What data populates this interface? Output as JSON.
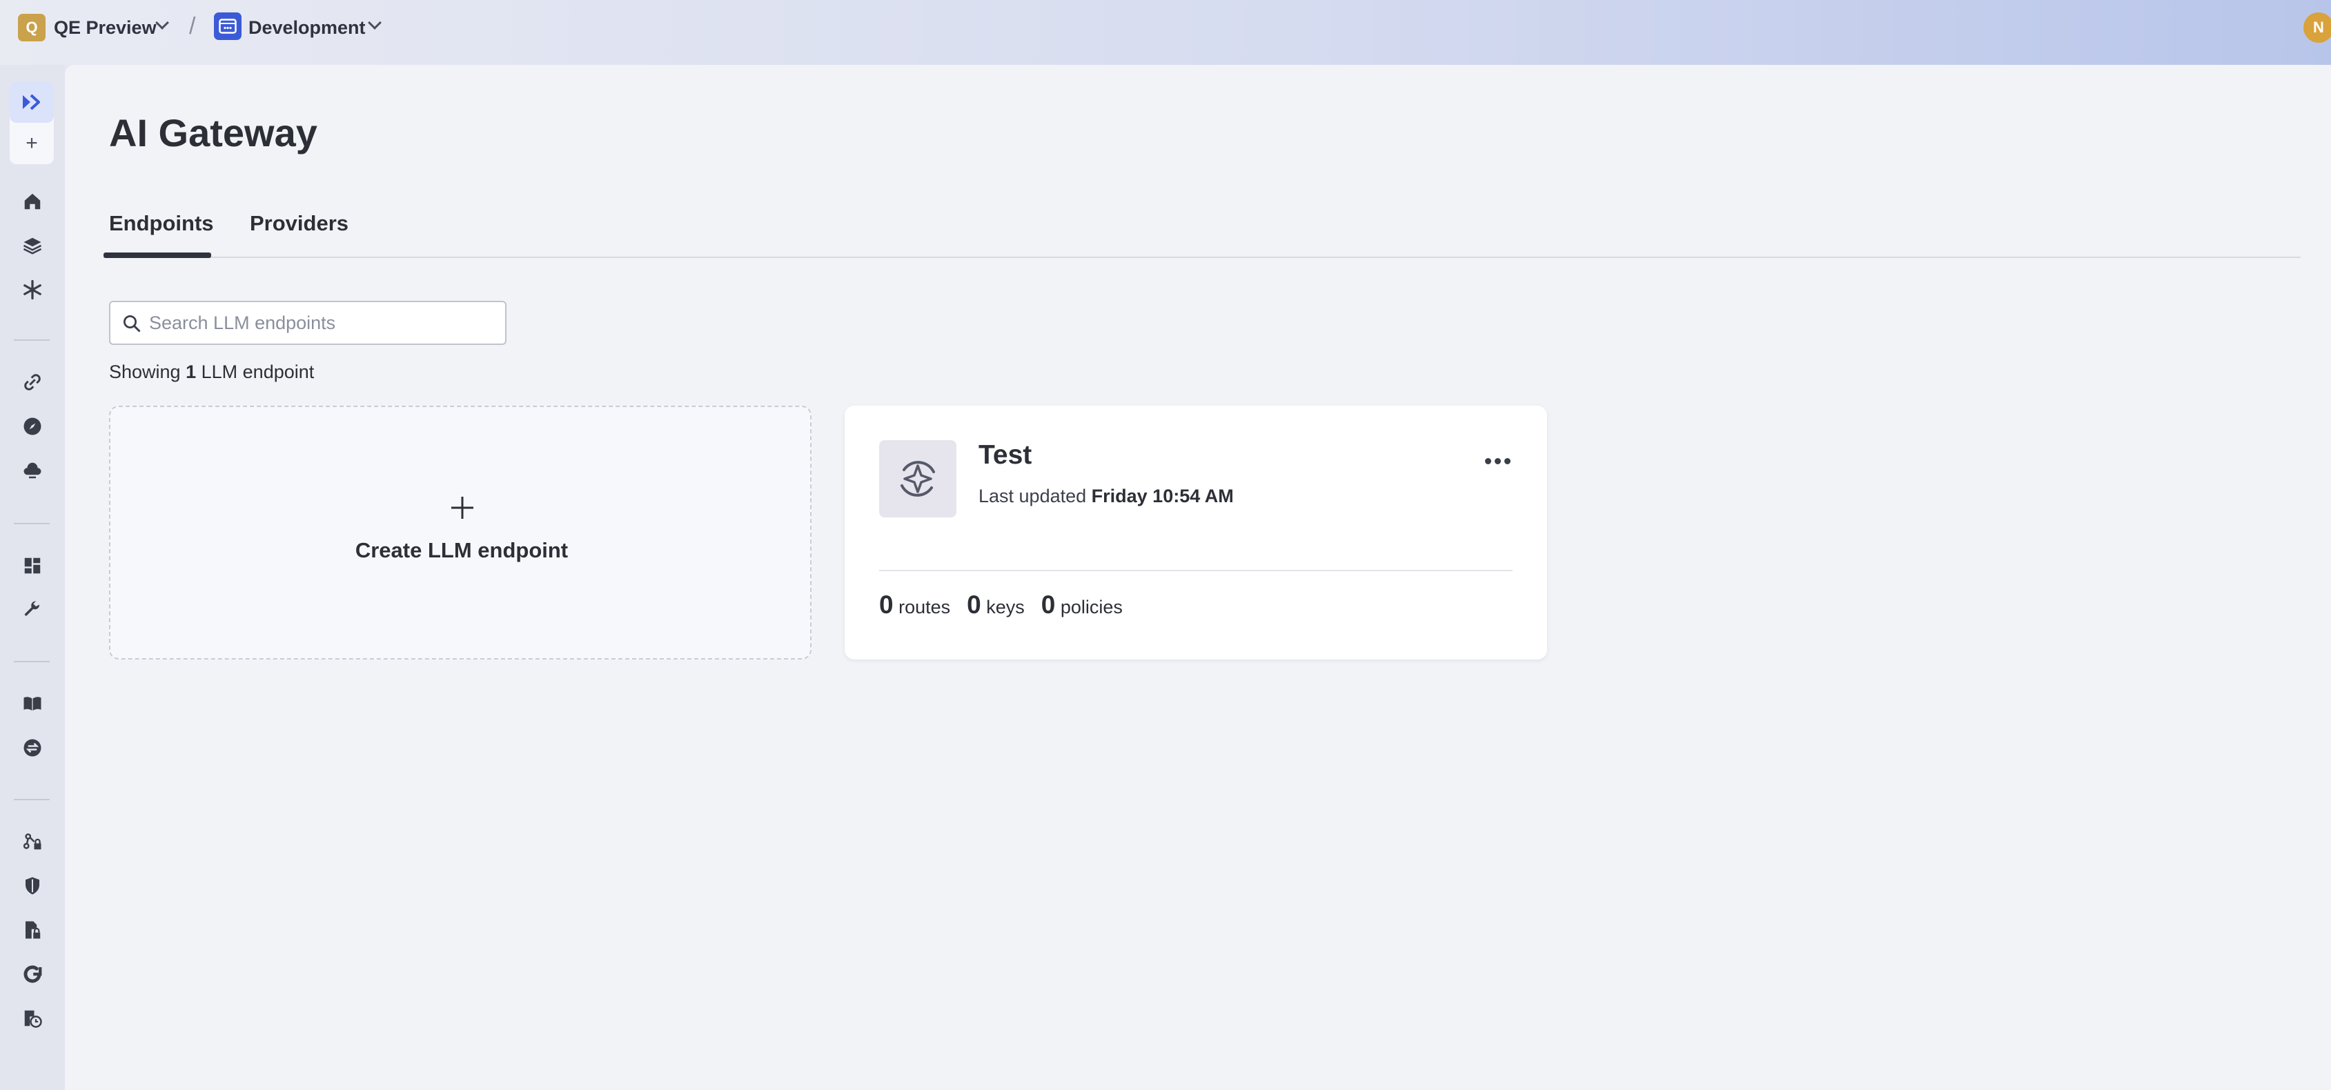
{
  "topbar": {
    "org": {
      "initial": "Q",
      "name": "QE Preview"
    },
    "environment": {
      "name": "Development"
    },
    "separator": "/",
    "user_initial": "N"
  },
  "sidebar": {
    "items": [
      {
        "icon": "collapse-sidebar-icon"
      },
      {
        "icon": "plus-icon",
        "label": "+"
      },
      {
        "icon": "home-icon"
      },
      {
        "icon": "layers-icon"
      },
      {
        "icon": "snowflake-icon"
      },
      {
        "icon": "link-icon"
      },
      {
        "icon": "compass-icon"
      },
      {
        "icon": "cloud-icon"
      },
      {
        "icon": "dashboard-icon"
      },
      {
        "icon": "wrench-icon"
      },
      {
        "icon": "book-icon"
      },
      {
        "icon": "swap-icon"
      },
      {
        "icon": "network-lock-icon"
      },
      {
        "icon": "shield-icon"
      },
      {
        "icon": "document-lock-icon"
      },
      {
        "icon": "refresh-icon"
      },
      {
        "icon": "history-icon"
      }
    ]
  },
  "page": {
    "title": "AI Gateway",
    "tabs": [
      {
        "label": "Endpoints",
        "active": true
      },
      {
        "label": "Providers",
        "active": false
      }
    ],
    "search": {
      "placeholder": "Search LLM endpoints",
      "value": ""
    },
    "showing": {
      "prefix": "Showing",
      "count": "1",
      "suffix": "LLM endpoint"
    }
  },
  "create_card": {
    "label": "Create LLM endpoint"
  },
  "endpoints": [
    {
      "name": "Test",
      "updated_prefix": "Last updated",
      "updated_value": "Friday 10:54 AM",
      "routes": "0",
      "routes_label": "routes",
      "keys": "0",
      "keys_label": "keys",
      "policies": "0",
      "policies_label": "policies"
    }
  ],
  "colors": {
    "org_badge": "#c9a24b",
    "env_badge": "#3b5bd6",
    "avatar": "#d9a23a",
    "main_bg": "#f1f3f7"
  }
}
